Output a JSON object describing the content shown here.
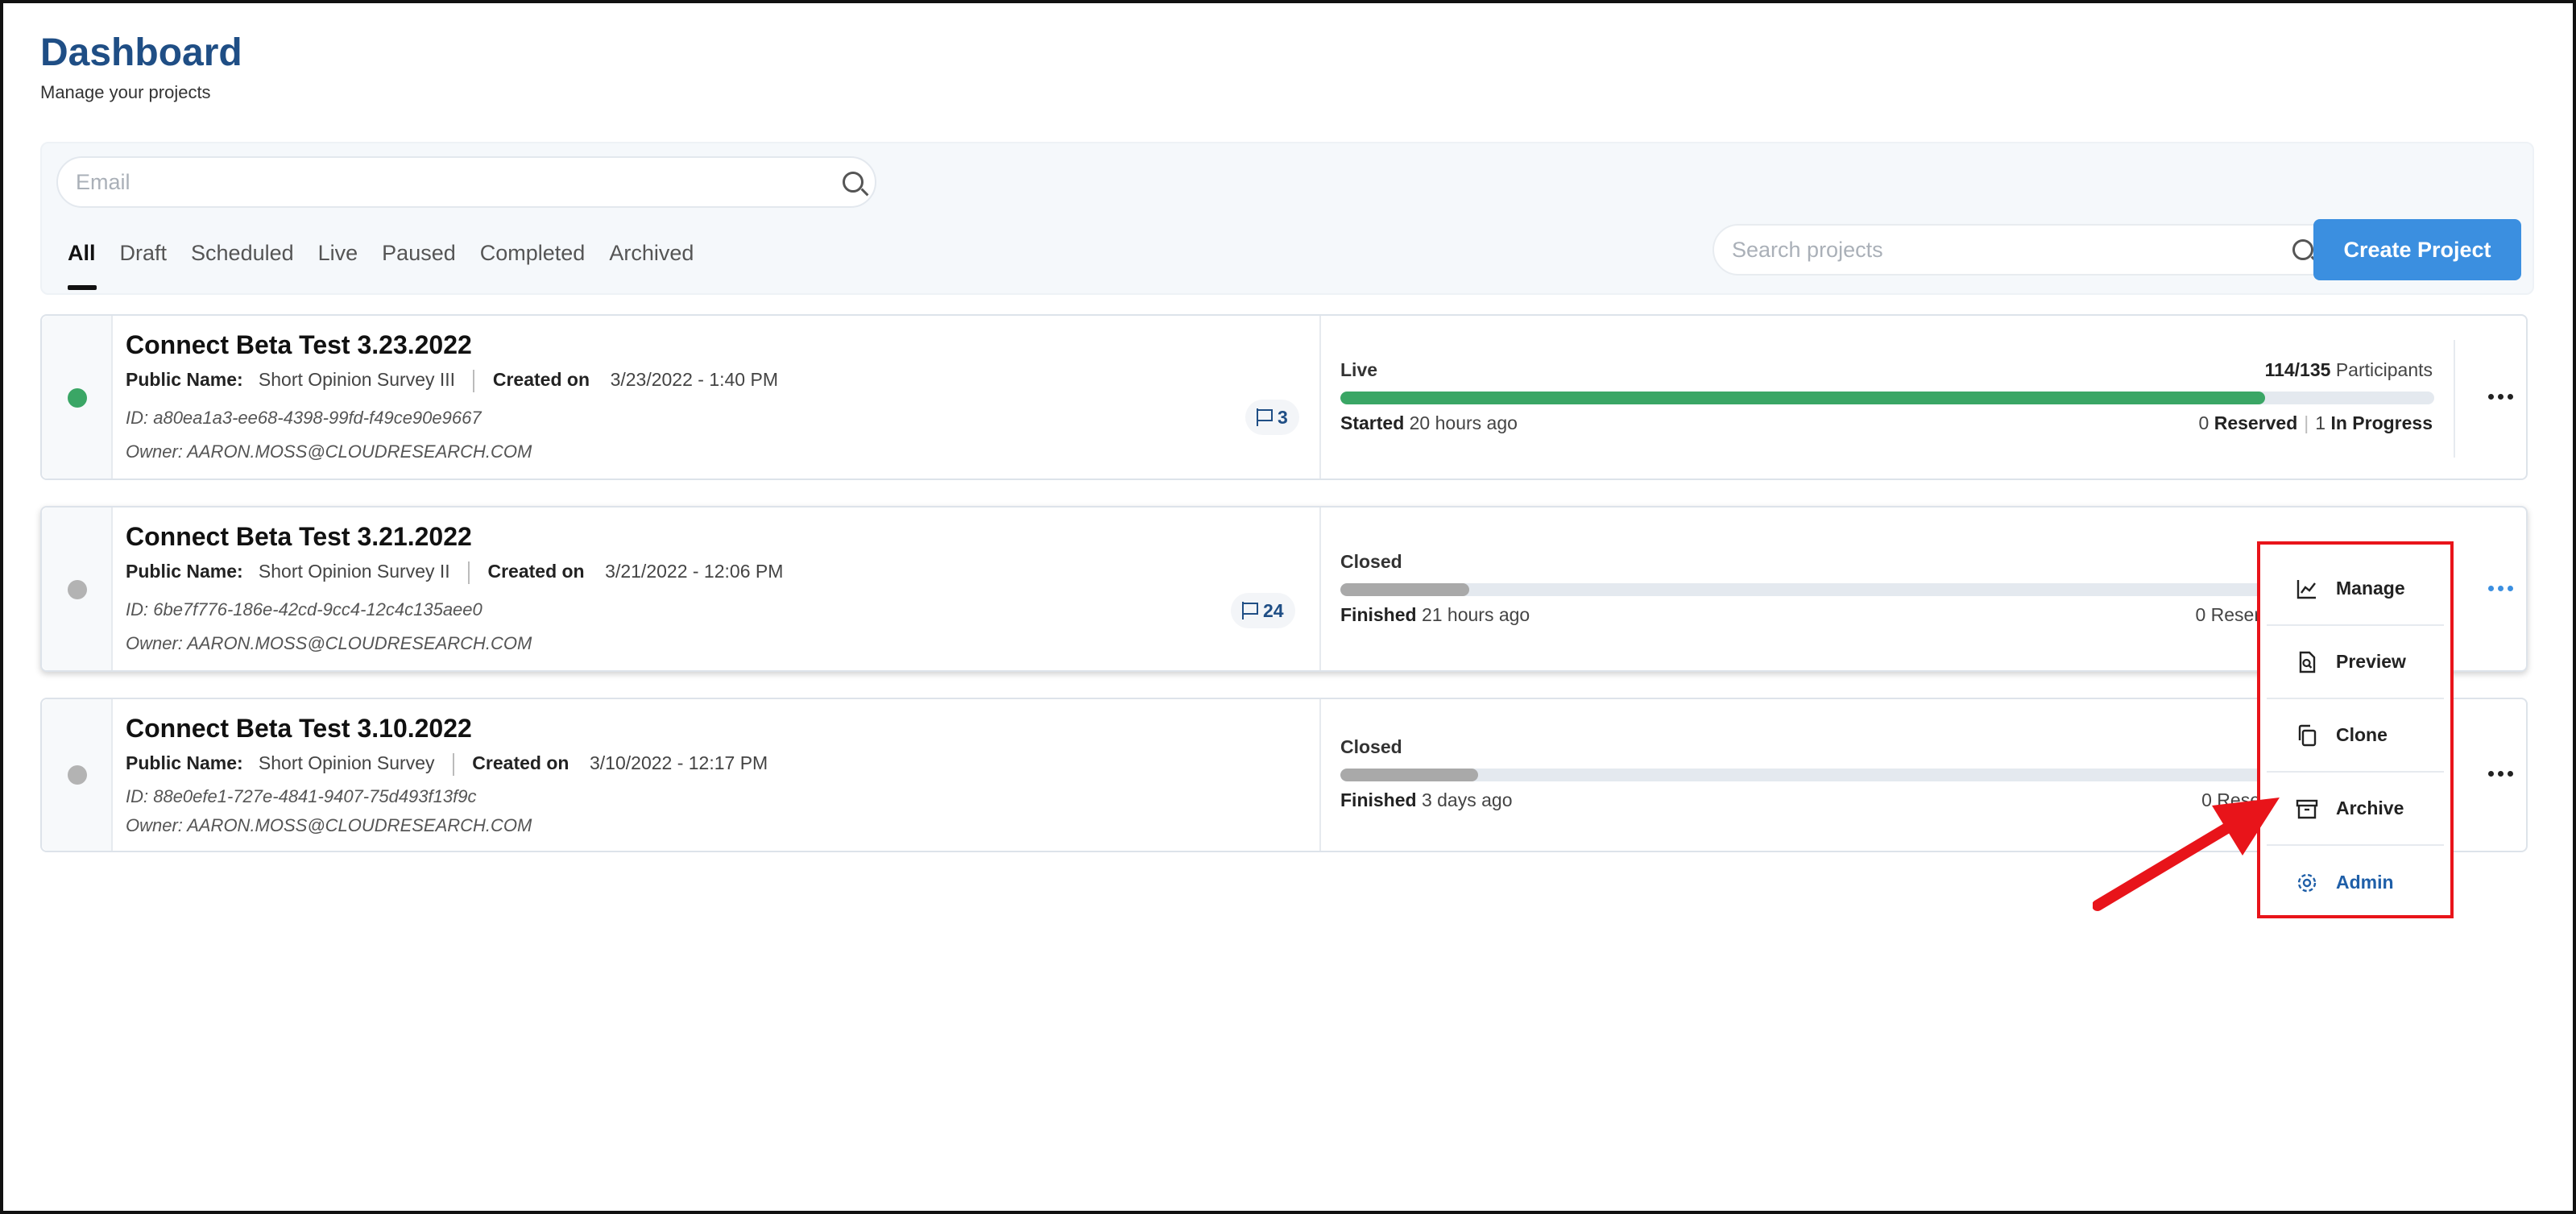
{
  "header": {
    "title": "Dashboard",
    "subtitle": "Manage your projects"
  },
  "filters": {
    "email_placeholder": "Email",
    "tabs": [
      "All",
      "Draft",
      "Scheduled",
      "Live",
      "Paused",
      "Completed",
      "Archived"
    ],
    "active_tab": "All",
    "search_placeholder": "Search projects",
    "create_label": "Create Project"
  },
  "labels": {
    "public_name": "Public Name:",
    "created_on": "Created on",
    "participants": "Participants",
    "reserved": "Reserved",
    "in_progress": "In Progress"
  },
  "projects": [
    {
      "name": "Connect Beta Test 3.23.2022",
      "public_name": "Short Opinion Survey III",
      "created": "3/23/2022 - 1:40 PM",
      "id": "ID: a80ea1a3-ee68-4398-99fd-f49ce90e9667",
      "owner": "Owner: AARON.MOSS@CLOUDRESEARCH.COM",
      "flags": "3",
      "status": "Live",
      "participants": "114/135",
      "progress": 0.845,
      "time_label": "Started",
      "time_value": "20 hours ago",
      "reserved": "0",
      "in_progress": "1",
      "status_color": "#3aa665",
      "bar_color": "#3aa665"
    },
    {
      "name": "Connect Beta Test 3.21.2022",
      "public_name": "Short Opinion Survey II",
      "created": "3/21/2022 - 12:06 PM",
      "id": "ID: 6be7f776-186e-42cd-9cc4-12c4c135aee0",
      "owner": "Owner: AARON.MOSS@CLOUDRESEARCH.COM",
      "flags": "24",
      "status": "Closed",
      "reserved_partial": "0 Reser",
      "time_label": "Finished",
      "time_value": "21 hours ago",
      "progress": 0.118,
      "status_color": "#b3b3b3",
      "bar_color": "#a9a9a9"
    },
    {
      "name": "Connect Beta Test 3.10.2022",
      "public_name": "Short Opinion Survey",
      "created": "3/10/2022 - 12:17 PM",
      "id": "ID: 88e0efe1-727e-4841-9407-75d493f13f9c",
      "owner": "Owner: AARON.MOSS@CLOUDRESEARCH.COM",
      "status": "Closed",
      "reserved_partial": "0 Rese",
      "time_label": "Finished",
      "time_value": "3 days ago",
      "progress": 0.126,
      "status_color": "#b3b3b3",
      "bar_color": "#a9a9a9"
    }
  ],
  "menu": {
    "items": [
      {
        "label": "Manage",
        "icon": "chart-line-icon"
      },
      {
        "label": "Preview",
        "icon": "document-search-icon"
      },
      {
        "label": "Clone",
        "icon": "copy-icon"
      },
      {
        "label": "Archive",
        "icon": "archive-box-icon"
      },
      {
        "label": "Admin",
        "icon": "gear-icon"
      }
    ],
    "highlight_color": "#e8141a"
  }
}
